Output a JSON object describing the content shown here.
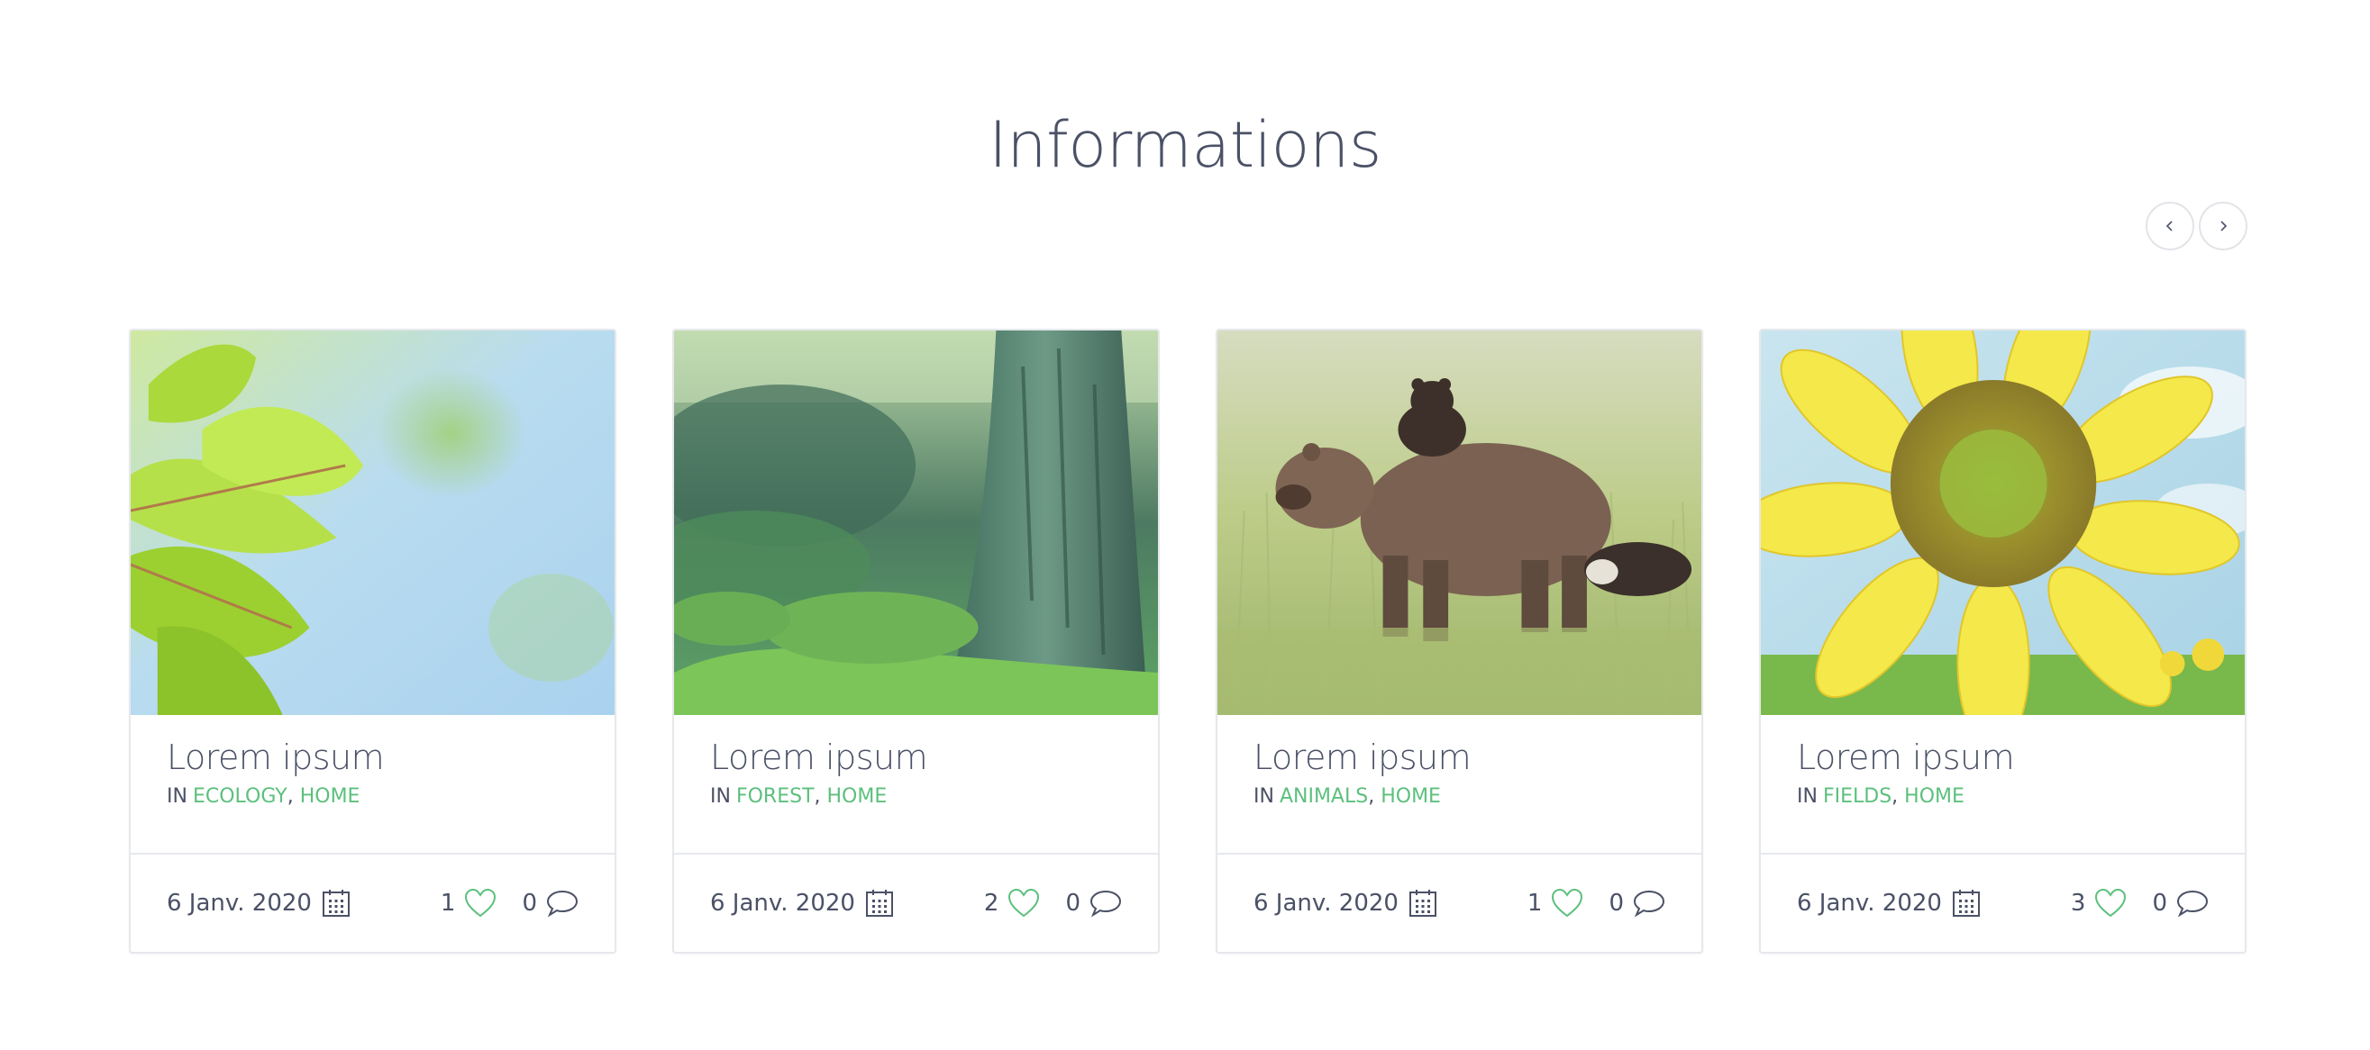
{
  "section": {
    "title": "Informations"
  },
  "navigation": {
    "prev_icon": "chevron-left-icon",
    "next_icon": "chevron-right-icon"
  },
  "colors": {
    "accent": "#5cc07d",
    "text": "#4b5166",
    "border": "#e6e8ec"
  },
  "cards": [
    {
      "image": "leaves-photo",
      "title": "Lorem ipsum",
      "in_label": "IN",
      "categories": [
        "ECOLOGY",
        "HOME"
      ],
      "date": "6 Janv. 2020",
      "likes": "1",
      "comments": "0"
    },
    {
      "image": "forest-photo",
      "title": "Lorem ipsum",
      "in_label": "IN",
      "categories": [
        "FOREST",
        "HOME"
      ],
      "date": "6 Janv. 2020",
      "likes": "2",
      "comments": "0"
    },
    {
      "image": "bears-photo",
      "title": "Lorem ipsum",
      "in_label": "IN",
      "categories": [
        "ANIMALS",
        "HOME"
      ],
      "date": "6 Janv. 2020",
      "likes": "1",
      "comments": "0"
    },
    {
      "image": "sunflower-photo",
      "title": "Lorem ipsum",
      "in_label": "IN",
      "categories": [
        "FIELDS",
        "HOME"
      ],
      "date": "6 Janv. 2020",
      "likes": "3",
      "comments": "0"
    }
  ]
}
